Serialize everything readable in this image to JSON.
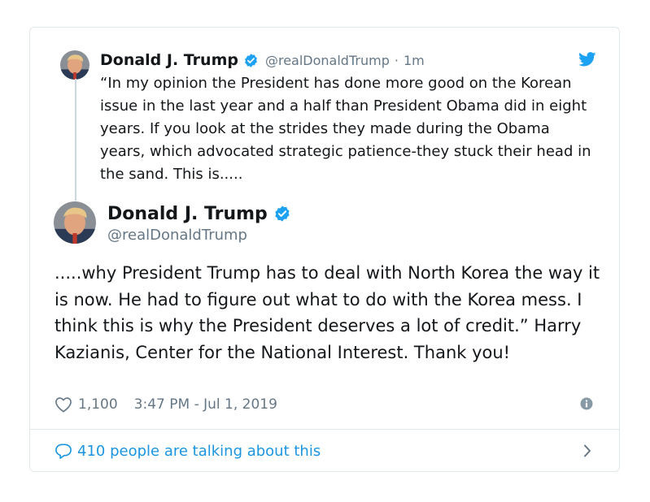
{
  "quoted_tweet": {
    "name": "Donald J. Trump",
    "handle": "@realDonaldTrump",
    "separator": "·",
    "time": "1m",
    "text": "“In my opinion the President has done more good on the Korean issue in the last year and a half than President Obama did in eight years. If you look at the strides they made during the Obama years, which advocated strategic patience-they stuck their head in the sand. This is.....",
    "avatar_icon": "trump-avatar",
    "verified_icon": "verified-badge-icon",
    "brand_icon": "twitter-bird-icon"
  },
  "main_tweet": {
    "name": "Donald J. Trump",
    "handle": "@realDonaldTrump",
    "text": ".....why President Trump has to deal with North Korea the way it is now. He had to figure out what to do with the Korea mess. I think this is why the President deserves a lot of credit.” Harry Kazianis, Center for the National Interest. Thank you!",
    "likes": "1,100",
    "timestamp": "3:47 PM - Jul 1, 2019",
    "like_icon": "heart-icon",
    "info_icon": "info-icon"
  },
  "footer": {
    "label": "410 people are talking about this",
    "comment_icon": "comment-icon",
    "chevron_icon": "chevron-right-icon"
  },
  "colors": {
    "twitter_blue": "#1da1f2",
    "link_blue": "#1b95e0",
    "secondary_text": "#657786",
    "border": "#e1e8ed"
  }
}
